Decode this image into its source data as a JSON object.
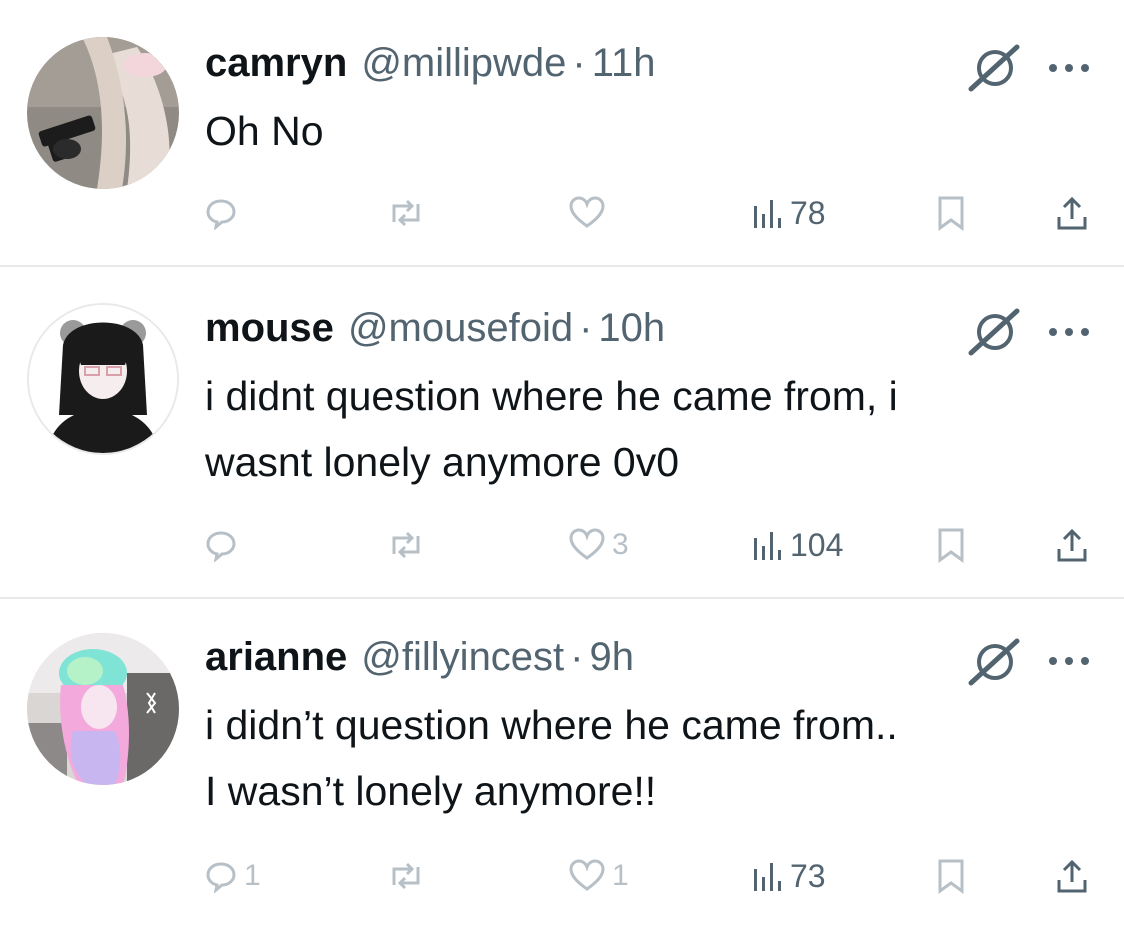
{
  "tweets": [
    {
      "display_name": "camryn",
      "handle": "@millipwde",
      "separator": "·",
      "time": "11h",
      "text_lines": [
        "Oh No"
      ],
      "reply_count": "",
      "retweet_count": "",
      "like_count": "",
      "views_count": "78"
    },
    {
      "display_name": "mouse",
      "handle": "@mousefoid",
      "separator": "·",
      "time": "10h",
      "text_lines": [
        "i didnt question where he came from, i",
        "wasnt lonely anymore 0v0"
      ],
      "reply_count": "",
      "retweet_count": "",
      "like_count": "3",
      "views_count": "104"
    },
    {
      "display_name": "arianne",
      "handle": "@fillyincest",
      "separator": "·",
      "time": "9h",
      "text_lines": [
        "i didn’t question where he came from..",
        "I wasn’t lonely anymore!!"
      ],
      "reply_count": "1",
      "retweet_count": "",
      "like_count": "1",
      "views_count": "73"
    }
  ],
  "icons": {
    "grok": "grok-icon",
    "more": "more-horizontal-icon",
    "reply": "reply-icon",
    "retweet": "retweet-icon",
    "like": "heart-icon",
    "views": "views-bar-chart-icon",
    "bookmark": "bookmark-icon",
    "share": "share-icon"
  },
  "colors": {
    "text_primary": "#0f1419",
    "text_secondary": "#536471",
    "icon_muted": "#b7c0c7",
    "divider": "#e7e9ea"
  }
}
